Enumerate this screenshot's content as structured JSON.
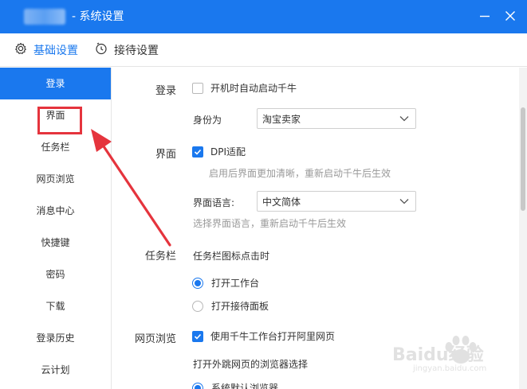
{
  "window": {
    "title": " - 系统设置",
    "buttons": [
      "minimize-icon",
      "close-icon"
    ]
  },
  "tabs": [
    {
      "label": "基础设置",
      "icon": "gear-icon",
      "active": true
    },
    {
      "label": "接待设置",
      "icon": "clock-icon",
      "active": false
    }
  ],
  "sidebar": {
    "items": [
      {
        "label": "登录",
        "active": true
      },
      {
        "label": "界面",
        "active": false
      },
      {
        "label": "任务栏",
        "active": false
      },
      {
        "label": "网页浏览",
        "active": false
      },
      {
        "label": "消息中心",
        "active": false
      },
      {
        "label": "快捷键",
        "active": false
      },
      {
        "label": "密码",
        "active": false
      },
      {
        "label": "下载",
        "active": false
      },
      {
        "label": "登录历史",
        "active": false
      },
      {
        "label": "云计划",
        "active": false
      }
    ]
  },
  "sections": {
    "login": {
      "label": "登录",
      "autostart": {
        "label": "开机时自动启动千牛",
        "checked": false
      },
      "identity": {
        "label": "身份为",
        "value": "淘宝卖家"
      }
    },
    "interface": {
      "label": "界面",
      "dpi": {
        "label": "DPI适配",
        "checked": true,
        "hint": "启用后界面更加清晰，重新启动千牛后生效"
      },
      "language": {
        "label": "界面语言:",
        "value": "中文简体",
        "hint": "选择界面语言，重新启动千牛后生效"
      }
    },
    "taskbar": {
      "label": "任务栏",
      "subtitle": "任务栏图标点击时",
      "options": [
        {
          "label": "打开工作台",
          "selected": true
        },
        {
          "label": "打开接待面板",
          "selected": false
        }
      ]
    },
    "browsing": {
      "label": "网页浏览",
      "use_workbench": {
        "label": "使用千牛工作台打开阿里网页",
        "checked": true
      },
      "subtitle": "打开外跳网页的浏览器选择",
      "option_partial": {
        "label": "系统默认浏览器",
        "selected": true
      }
    }
  },
  "watermark": {
    "brand": "Baidu经验",
    "url": "jingyan.baidu.com"
  },
  "colors": {
    "accent": "#1a78ee",
    "highlight": "#e5343d"
  }
}
